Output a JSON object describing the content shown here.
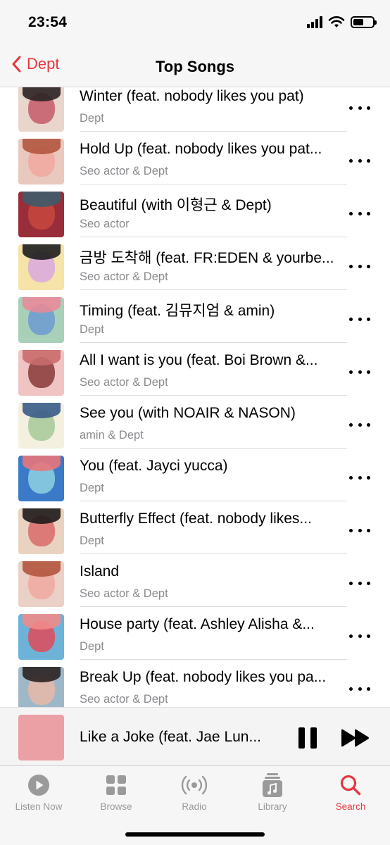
{
  "status": {
    "time": "23:54",
    "battery_level": 0.55
  },
  "nav": {
    "back_label": "Dept",
    "title": "Top Songs"
  },
  "songs": [
    {
      "title": "Winter (feat. nobody likes you pat)",
      "artist": "Dept",
      "art": [
        "#e8d6cc",
        "#2a2222",
        "#c45a6a"
      ]
    },
    {
      "title": "Hold Up (feat. nobody likes you pat...",
      "artist": "Seo actor & Dept",
      "art": [
        "#e9c9bd",
        "#b3553e",
        "#f0a8a0"
      ]
    },
    {
      "title": "Beautiful (with 이형근 & Dept)",
      "artist": "Seo actor",
      "art": [
        "#9a2d3a",
        "#3e5c6a",
        "#c8483e"
      ]
    },
    {
      "title": "금방 도착해 (feat. FR:EDEN & yourbe...",
      "artist": "Seo actor & Dept",
      "art": [
        "#f5e3a8",
        "#1d1d1d",
        "#d9a8e0"
      ]
    },
    {
      "title": "Timing (feat. 김뮤지엄 & amin)",
      "artist": "Dept",
      "art": [
        "#a8d0b8",
        "#e88a9a",
        "#6d9bd0"
      ]
    },
    {
      "title": "All I want is you (feat. Boi Brown &...",
      "artist": "Seo actor & Dept",
      "art": [
        "#f1c4c4",
        "#c96d6d",
        "#8a3a3a"
      ]
    },
    {
      "title": "See you (with NOAIR & NASON)",
      "artist": "amin & Dept",
      "art": [
        "#f4f0df",
        "#3a5a8a",
        "#a6c99a"
      ]
    },
    {
      "title": "You (feat. Jayci yucca)",
      "artist": "Dept",
      "art": [
        "#3a7ac7",
        "#e8767a",
        "#8fd0e0"
      ]
    },
    {
      "title": "Butterfly Effect (feat. nobody likes...",
      "artist": "Dept",
      "art": [
        "#e9d3c0",
        "#1e1a1a",
        "#d86a6a"
      ]
    },
    {
      "title": "Island",
      "artist": "Seo actor & Dept",
      "art": [
        "#ead0c6",
        "#b3553e",
        "#f0a8a0"
      ]
    },
    {
      "title": "House party (feat. Ashley Alisha &...",
      "artist": "Dept",
      "art": [
        "#6db3d8",
        "#f08a8a",
        "#e24a5a"
      ]
    },
    {
      "title": "Break Up (feat. nobody likes you pa...",
      "artist": "Seo actor & Dept",
      "art": [
        "#9fb8c8",
        "#2a2222",
        "#e8b8a8"
      ]
    }
  ],
  "now_playing": {
    "title": "Like a Joke (feat. Jae Lun...",
    "art": [
      "#eaa0a4",
      "#c9565e",
      "#f6cfcf"
    ]
  },
  "tabs": [
    {
      "label": "Listen Now",
      "icon": "play-circle-icon",
      "active": false
    },
    {
      "label": "Browse",
      "icon": "grid-icon",
      "active": false
    },
    {
      "label": "Radio",
      "icon": "radio-waves-icon",
      "active": false
    },
    {
      "label": "Library",
      "icon": "library-icon",
      "active": false
    },
    {
      "label": "Search",
      "icon": "search-icon",
      "active": true
    }
  ],
  "colors": {
    "accent": "#e5383f",
    "secondary_text": "#8a8a8e"
  }
}
